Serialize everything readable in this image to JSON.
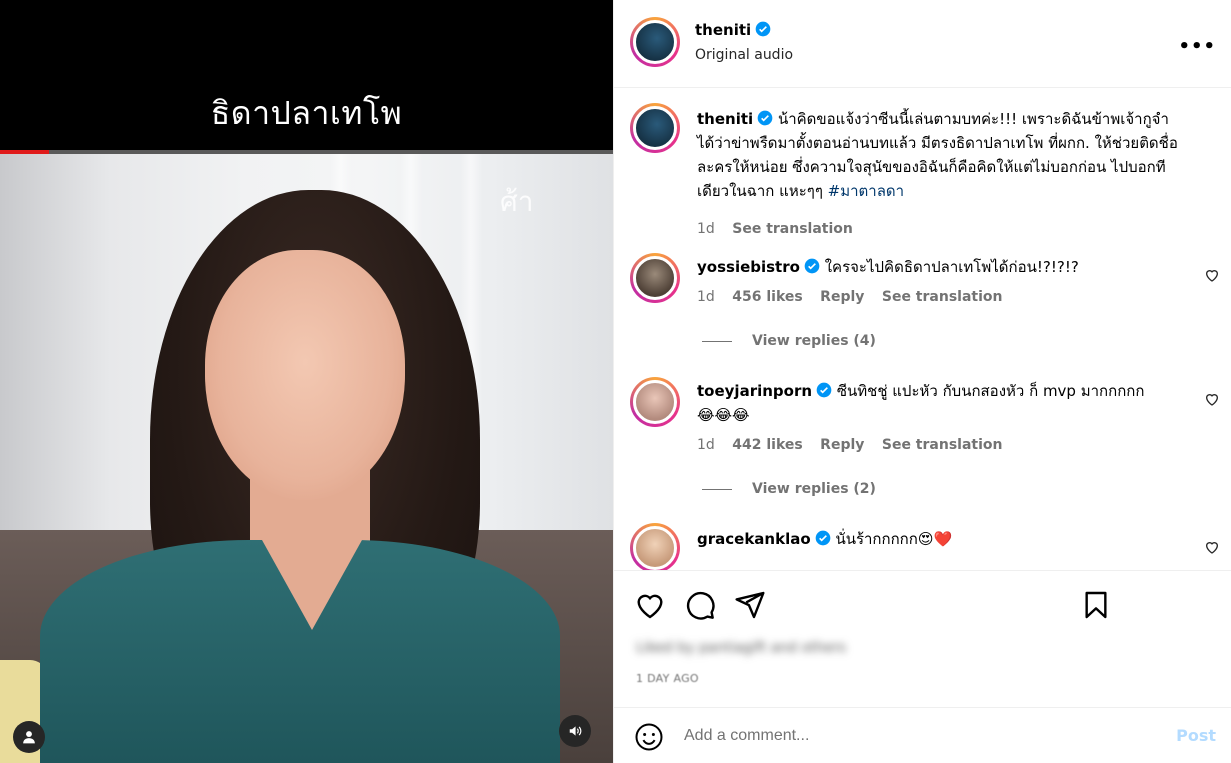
{
  "media": {
    "caption_overlay": "ธิดาปลาเทโพ",
    "progress": 0.08
  },
  "post": {
    "username": "theniti",
    "audio": "Original audio",
    "more_label": "•••",
    "caption_text": "น้าคิดขอแจ้งว่าซีนนี้เล่นตามบทค่ะ!!! เพราะดิฉันข้าพเจ้ากูจำได้ว่าข่าพรืดมาตั้งตอนอ่านบทแล้ว มีตรงธิดาปลาเทโพ ที่ผกก. ให้ช่วยติดชื่อละครให้หน่อย ซึ่งความใจสุนัขของอิฉันก็คือคิดให้แต่ไม่บอกก่อน ไปบอกทีเดียวในฉาก แหะๆๆ",
    "hashtag": "#มาตาลดา",
    "time": "1d",
    "see_translation": "See translation"
  },
  "comments": [
    {
      "username": "yossiebistro",
      "text": "ใครจะไปคิดธิดาปลาเทโพได้ก่อน!?!?!?",
      "time": "1d",
      "likes": "456 likes",
      "reply": "Reply",
      "see_translation": "See translation",
      "view_replies": "View replies (4)"
    },
    {
      "username": "toeyjarinporn",
      "text": "ซีนทิชชู่ แปะหัว กับนกสองหัว ก็ mvp มากกกกก",
      "emoji": "😂😂😂",
      "time": "1d",
      "likes": "442 likes",
      "reply": "Reply",
      "see_translation": "See translation",
      "view_replies": "View replies (2)"
    },
    {
      "username": "gracekanklao",
      "text": "นั่นร้ากกกกก",
      "emoji": "😍❤️"
    }
  ],
  "footer": {
    "liked_by": "Liked by pantiagift and others",
    "date": "1 DAY AGO",
    "add_comment_placeholder": "Add a comment...",
    "post_label": "Post"
  },
  "colors": {
    "verified": "#0095f6",
    "link": "#00376b",
    "muted": "#737373",
    "post_disabled": "#b3dbff",
    "progress": "#e01a1a"
  },
  "icons": [
    "user-icon",
    "volume-icon",
    "verified-icon",
    "more-icon",
    "heart-icon",
    "comment-icon",
    "share-icon",
    "bookmark-icon",
    "emoji-icon"
  ]
}
